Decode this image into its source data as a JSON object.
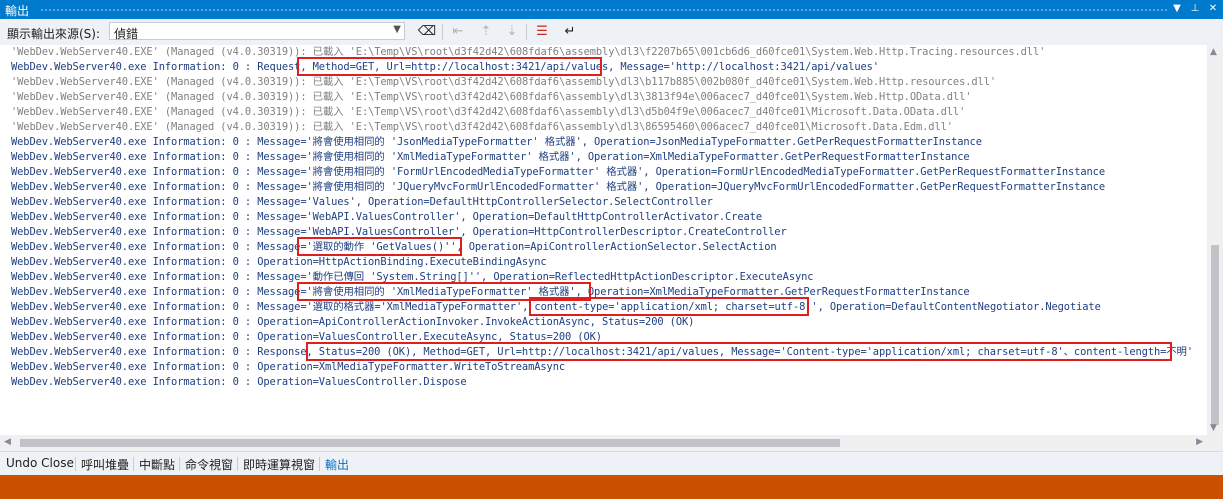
{
  "window": {
    "title": "輸出"
  },
  "toolbar": {
    "source_label": "顯示輸出來源(S):",
    "source_value": "偵錯",
    "icons": [
      "eraser-icon",
      "prev-message-icon",
      "next-message-icon",
      "clear-all-icon",
      "word-wrap-icon"
    ]
  },
  "output_lines": [
    "'WebDev.WebServer40.EXE' (Managed (v4.0.30319)): 已載入 'E:\\Temp\\VS\\root\\d3f42d42\\608fdaf6\\assembly\\dl3\\f2207b65\\001cb6d6_d60fce01\\System.Web.Http.Tracing.resources.dll'",
    "WebDev.WebServer40.exe Information: 0 : Request, Method=GET, Url=http://localhost:3421/api/values, Message='http://localhost:3421/api/values'",
    "'WebDev.WebServer40.EXE' (Managed (v4.0.30319)): 已載入 'E:\\Temp\\VS\\root\\d3f42d42\\608fdaf6\\assembly\\dl3\\b117b885\\002b080f_d40fce01\\System.Web.Http.resources.dll'",
    "'WebDev.WebServer40.EXE' (Managed (v4.0.30319)): 已載入 'E:\\Temp\\VS\\root\\d3f42d42\\608fdaf6\\assembly\\dl3\\3813f94e\\006acec7_d40fce01\\System.Web.Http.OData.dll'",
    "'WebDev.WebServer40.EXE' (Managed (v4.0.30319)): 已載入 'E:\\Temp\\VS\\root\\d3f42d42\\608fdaf6\\assembly\\dl3\\d5b04f9e\\006acec7_d40fce01\\Microsoft.Data.OData.dll'",
    "'WebDev.WebServer40.EXE' (Managed (v4.0.30319)): 已載入 'E:\\Temp\\VS\\root\\d3f42d42\\608fdaf6\\assembly\\dl3\\86595460\\006acec7_d40fce01\\Microsoft.Data.Edm.dll'",
    "WebDev.WebServer40.exe Information: 0 : Message='將會使用相同的 'JsonMediaTypeFormatter' 格式器', Operation=JsonMediaTypeFormatter.GetPerRequestFormatterInstance",
    "WebDev.WebServer40.exe Information: 0 : Message='將會使用相同的 'XmlMediaTypeFormatter' 格式器', Operation=XmlMediaTypeFormatter.GetPerRequestFormatterInstance",
    "WebDev.WebServer40.exe Information: 0 : Message='將會使用相同的 'FormUrlEncodedMediaTypeFormatter' 格式器', Operation=FormUrlEncodedMediaTypeFormatter.GetPerRequestFormatterInstance",
    "WebDev.WebServer40.exe Information: 0 : Message='將會使用相同的 'JQueryMvcFormUrlEncodedFormatter' 格式器', Operation=JQueryMvcFormUrlEncodedFormatter.GetPerRequestFormatterInstance",
    "WebDev.WebServer40.exe Information: 0 : Message='Values', Operation=DefaultHttpControllerSelector.SelectController",
    "WebDev.WebServer40.exe Information: 0 : Message='WebAPI.ValuesController', Operation=DefaultHttpControllerActivator.Create",
    "WebDev.WebServer40.exe Information: 0 : Message='WebAPI.ValuesController', Operation=HttpControllerDescriptor.CreateController",
    "WebDev.WebServer40.exe Information: 0 : Message='選取的動作 'GetValues()'', Operation=ApiControllerActionSelector.SelectAction",
    "WebDev.WebServer40.exe Information: 0 : Operation=HttpActionBinding.ExecuteBindingAsync",
    "WebDev.WebServer40.exe Information: 0 : Message='動作已傳回 'System.String[]'', Operation=ReflectedHttpActionDescriptor.ExecuteAsync",
    "WebDev.WebServer40.exe Information: 0 : Message='將會使用相同的 'XmlMediaTypeFormatter' 格式器', Operation=XmlMediaTypeFormatter.GetPerRequestFormatterInstance",
    "WebDev.WebServer40.exe Information: 0 : Message='選取的格式器='XmlMediaTypeFormatter', content-type='application/xml; charset=utf-8'', Operation=DefaultContentNegotiator.Negotiate",
    "WebDev.WebServer40.exe Information: 0 : Operation=ApiControllerActionInvoker.InvokeActionAsync, Status=200 (OK)",
    "WebDev.WebServer40.exe Information: 0 : Operation=ValuesController.ExecuteAsync, Status=200 (OK)",
    "WebDev.WebServer40.exe Information: 0 : Response, Status=200 (OK), Method=GET, Url=http://localhost:3421/api/values, Message='Content-type='application/xml; charset=utf-8'、content-length=不明'",
    "WebDev.WebServer40.exe Information: 0 : Operation=XmlMediaTypeFormatter.WriteToStreamAsync",
    "WebDev.WebServer40.exe Information: 0 : Operation=ValuesController.Dispose"
  ],
  "bottom_tabs": [
    "Undo Close",
    "呼叫堆疊",
    "中斷點",
    "命令視窗",
    "即時運算視窗",
    "輸出"
  ],
  "colors": {
    "accent": "#007acc",
    "status_bar": "#ca5100",
    "highlight": "#e01e1e",
    "text": "#1f3f80",
    "load_text": "#808080"
  }
}
